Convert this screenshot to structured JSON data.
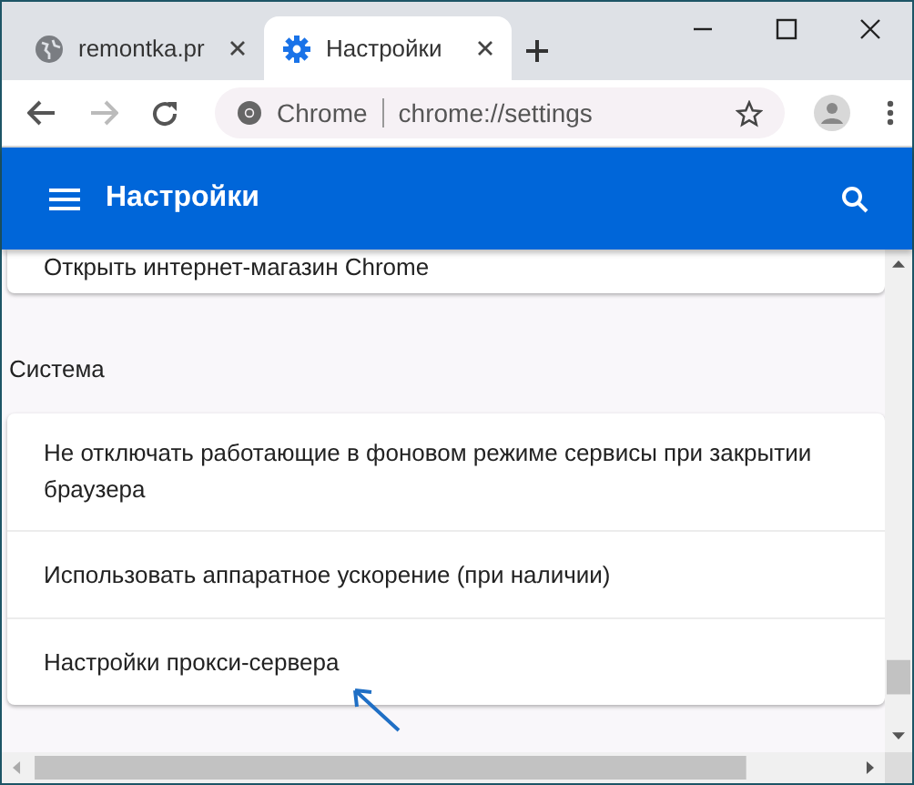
{
  "tabs": [
    {
      "label": "remontka.pr",
      "selected": false
    },
    {
      "label": "Настройки",
      "selected": true
    }
  ],
  "toolbar": {
    "site_label": "Chrome",
    "url": "chrome://settings"
  },
  "header": {
    "title": "Настройки"
  },
  "top_card": {
    "items": [
      "Открыть интернет-магазин Chrome"
    ]
  },
  "section": {
    "title": "Система",
    "items": [
      "Не отключать работающие в фоновом режиме сервисы при закрытии браузера",
      "Использовать аппаратное ускорение (при наличии)",
      "Настройки прокси-сервера"
    ]
  }
}
